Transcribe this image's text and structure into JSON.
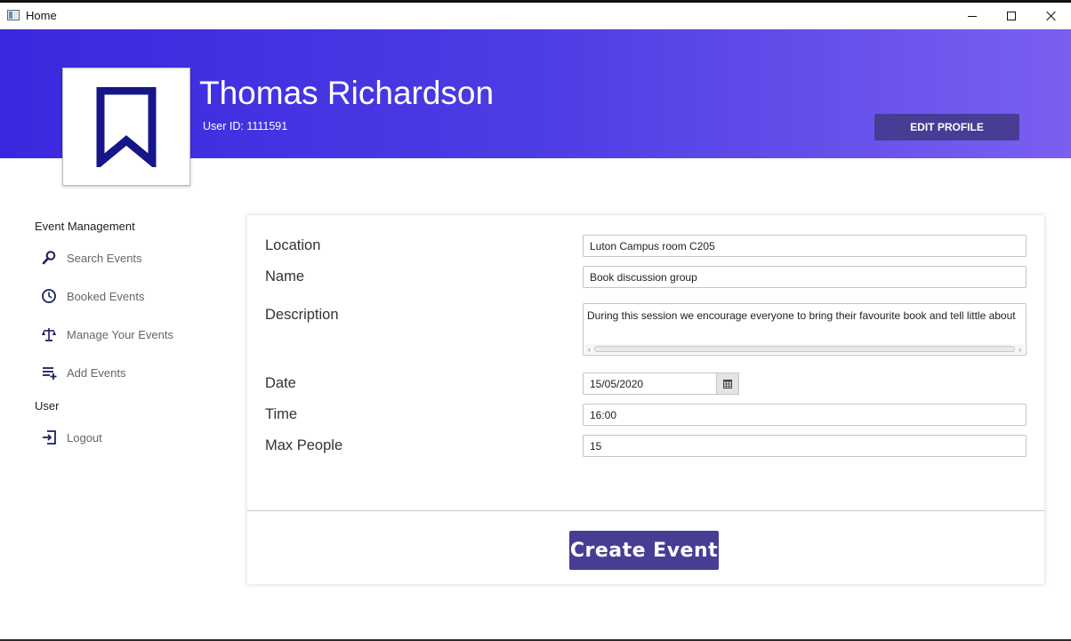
{
  "window": {
    "title": "Home",
    "controls": [
      "minimize",
      "maximize",
      "close"
    ]
  },
  "header": {
    "user_name": "Thomas Richardson",
    "user_id_label": "User ID:",
    "user_id": "1111591",
    "edit_profile_label": "EDIT PROFILE",
    "gradient_colors": [
      "#3a28e0",
      "#7b5ff2"
    ],
    "avatar_icon": "bookmark-icon"
  },
  "sidebar": {
    "event_section_title": "Event Management",
    "event_items": [
      {
        "label": "Search Events",
        "icon": "search-icon"
      },
      {
        "label": "Booked Events",
        "icon": "clock-icon"
      },
      {
        "label": "Manage Your Events",
        "icon": "scales-icon"
      },
      {
        "label": "Add Events",
        "icon": "add-list-icon"
      }
    ],
    "user_section_title": "User",
    "user_items": [
      {
        "label": "Logout",
        "icon": "logout-icon"
      }
    ]
  },
  "form": {
    "location": {
      "label": "Location",
      "value": "Luton Campus room C205"
    },
    "name": {
      "label": "Name",
      "value": "Book discussion group"
    },
    "description": {
      "label": "Description",
      "value": "During this session we encourage everyone to bring their favourite book and tell little about"
    },
    "date": {
      "label": "Date",
      "value": "15/05/2020",
      "icon": "calendar-icon"
    },
    "time": {
      "label": "Time",
      "value": "16:00"
    },
    "max_people": {
      "label": "Max People",
      "value": "15"
    },
    "submit_label": "Create Event"
  },
  "colors": {
    "accent_button": "#483d95",
    "avatar_icon": "#16168a"
  }
}
